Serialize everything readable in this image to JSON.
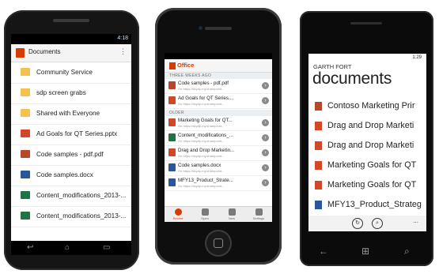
{
  "android": {
    "status_time": "4:18",
    "title": "Documents",
    "menu_icon": "overflow-menu-icon",
    "items": [
      {
        "type": "folder",
        "label": "Community Service"
      },
      {
        "type": "folder",
        "label": "sdp screen grabs"
      },
      {
        "type": "folder",
        "label": "Shared with Everyone"
      },
      {
        "type": "pptx",
        "label": "Ad Goals for QT Series.pptx"
      },
      {
        "type": "pdf",
        "label": "Code samples - pdf.pdf"
      },
      {
        "type": "docx",
        "label": "Code samples.docx"
      },
      {
        "type": "xlsx",
        "label": "Content_modifications_2013-..."
      },
      {
        "type": "xlsx",
        "label": "Content_modifications_2013-..."
      }
    ]
  },
  "iphone": {
    "brand": "Office",
    "section_recent": "THREE WEEKS AGO",
    "section_older": "OLDER",
    "recent": [
      {
        "type": "pdf",
        "title": "Code samples - pdf.pdf",
        "sub": "On https://skydp-my.sharepoint..."
      },
      {
        "type": "pptx",
        "title": "Ad Goals for QT Series....",
        "sub": "On https://skydp-my.sharepoint..."
      }
    ],
    "older": [
      {
        "type": "pptx",
        "title": "Marketing Goals for QT...",
        "sub": "On https://skydp-my.sharepoint..."
      },
      {
        "type": "xlsx",
        "title": "Content_modifications_...",
        "sub": "On https://skydp-my.sharepoint..."
      },
      {
        "type": "pptx",
        "title": "Drag and Drop Marketin...",
        "sub": "On https://skydp-my.sharepoint..."
      },
      {
        "type": "docx",
        "title": "Code samples.docx",
        "sub": "On https://skydp-my.sharepoint..."
      },
      {
        "type": "docx",
        "title": "MFY13_Product_Strate...",
        "sub": "On https://skydp-my.sharepoint..."
      }
    ],
    "tabs": [
      "Recent",
      "Open",
      "New",
      "Settings"
    ]
  },
  "winphone": {
    "status_time": "1:29",
    "owner": "GARTH FORT",
    "page_title": "documents",
    "items": [
      {
        "type": "pdf",
        "label": "Contoso Marketing Prir"
      },
      {
        "type": "pptx",
        "label": "Drag and Drop Marketi"
      },
      {
        "type": "pptx",
        "label": "Drag and Drop Marketi"
      },
      {
        "type": "pptx",
        "label": "Marketing Goals for QT"
      },
      {
        "type": "pptx",
        "label": "Marketing Goals for QT"
      },
      {
        "type": "docx",
        "label": "MFY13_Product_Strateg"
      }
    ],
    "appbar_more": "...",
    "appbar_icons": [
      "refresh-icon",
      "search-icon"
    ]
  }
}
